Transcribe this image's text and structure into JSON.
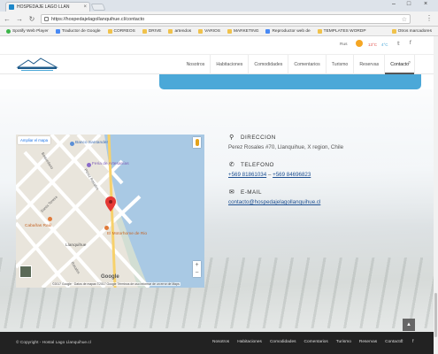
{
  "browser": {
    "tab_title": "HOSPEDAJE LAGO LLAN",
    "url": "https://hospedajelagollanquihue.cl/contacto",
    "bookmarks": [
      "Spotify Web Player",
      "Traductor de Google",
      "CORREOS",
      "DRIVE",
      "artendos",
      "VARIOS",
      "MARKETING",
      "Reproductor web de",
      "TEMPLATES WORDP"
    ],
    "other_bookmarks": "Otros marcadores"
  },
  "topstrip": {
    "lang": "Rus",
    "temp_c": "13°C",
    "temp_f": "4°C"
  },
  "nav": {
    "items": [
      "Nosotros",
      "Habitaciones",
      "Comodidades",
      "Comentarios",
      "Turismo",
      "Reservas",
      "Contacto"
    ],
    "active_index": 6
  },
  "map": {
    "enlarge_label": "Ampliar el mapa",
    "google_label": "Google",
    "attribution": "©2017 Google · Datos de mapas ©2017 Google   Términos de uso   Informar de un error de Maps",
    "labels": {
      "banco": "Banco Santander",
      "feria": "Feria de Artesanías",
      "cabanas": "Cabañas Raúl",
      "llanquihue": "Llanquihue",
      "motorhome": "El Motorhome de Rio",
      "st1": "Baquedano",
      "st2": "Pérez Rosales",
      "st3": "Santa Teresa",
      "st4": "Rosales"
    }
  },
  "contact": {
    "address_heading": "DIRECCION",
    "address": "Perez Rosales #70, Llanquihue, X region, Chile",
    "phone_heading": "TELEFONO",
    "phone1": "+569 81861034",
    "phone_sep": "–",
    "phone2": "+569 84696823",
    "email_heading": "E-MAIL",
    "email": "contacto@hospedajelagollanquihue.cl"
  },
  "footer": {
    "copyright": "© Copyright - Hostal Lago Llanquihue.cl",
    "links": [
      "Nosotros",
      "Habitaciones",
      "Comodidades",
      "Comentarios",
      "Turismo",
      "Reservas",
      "Contacto"
    ]
  }
}
